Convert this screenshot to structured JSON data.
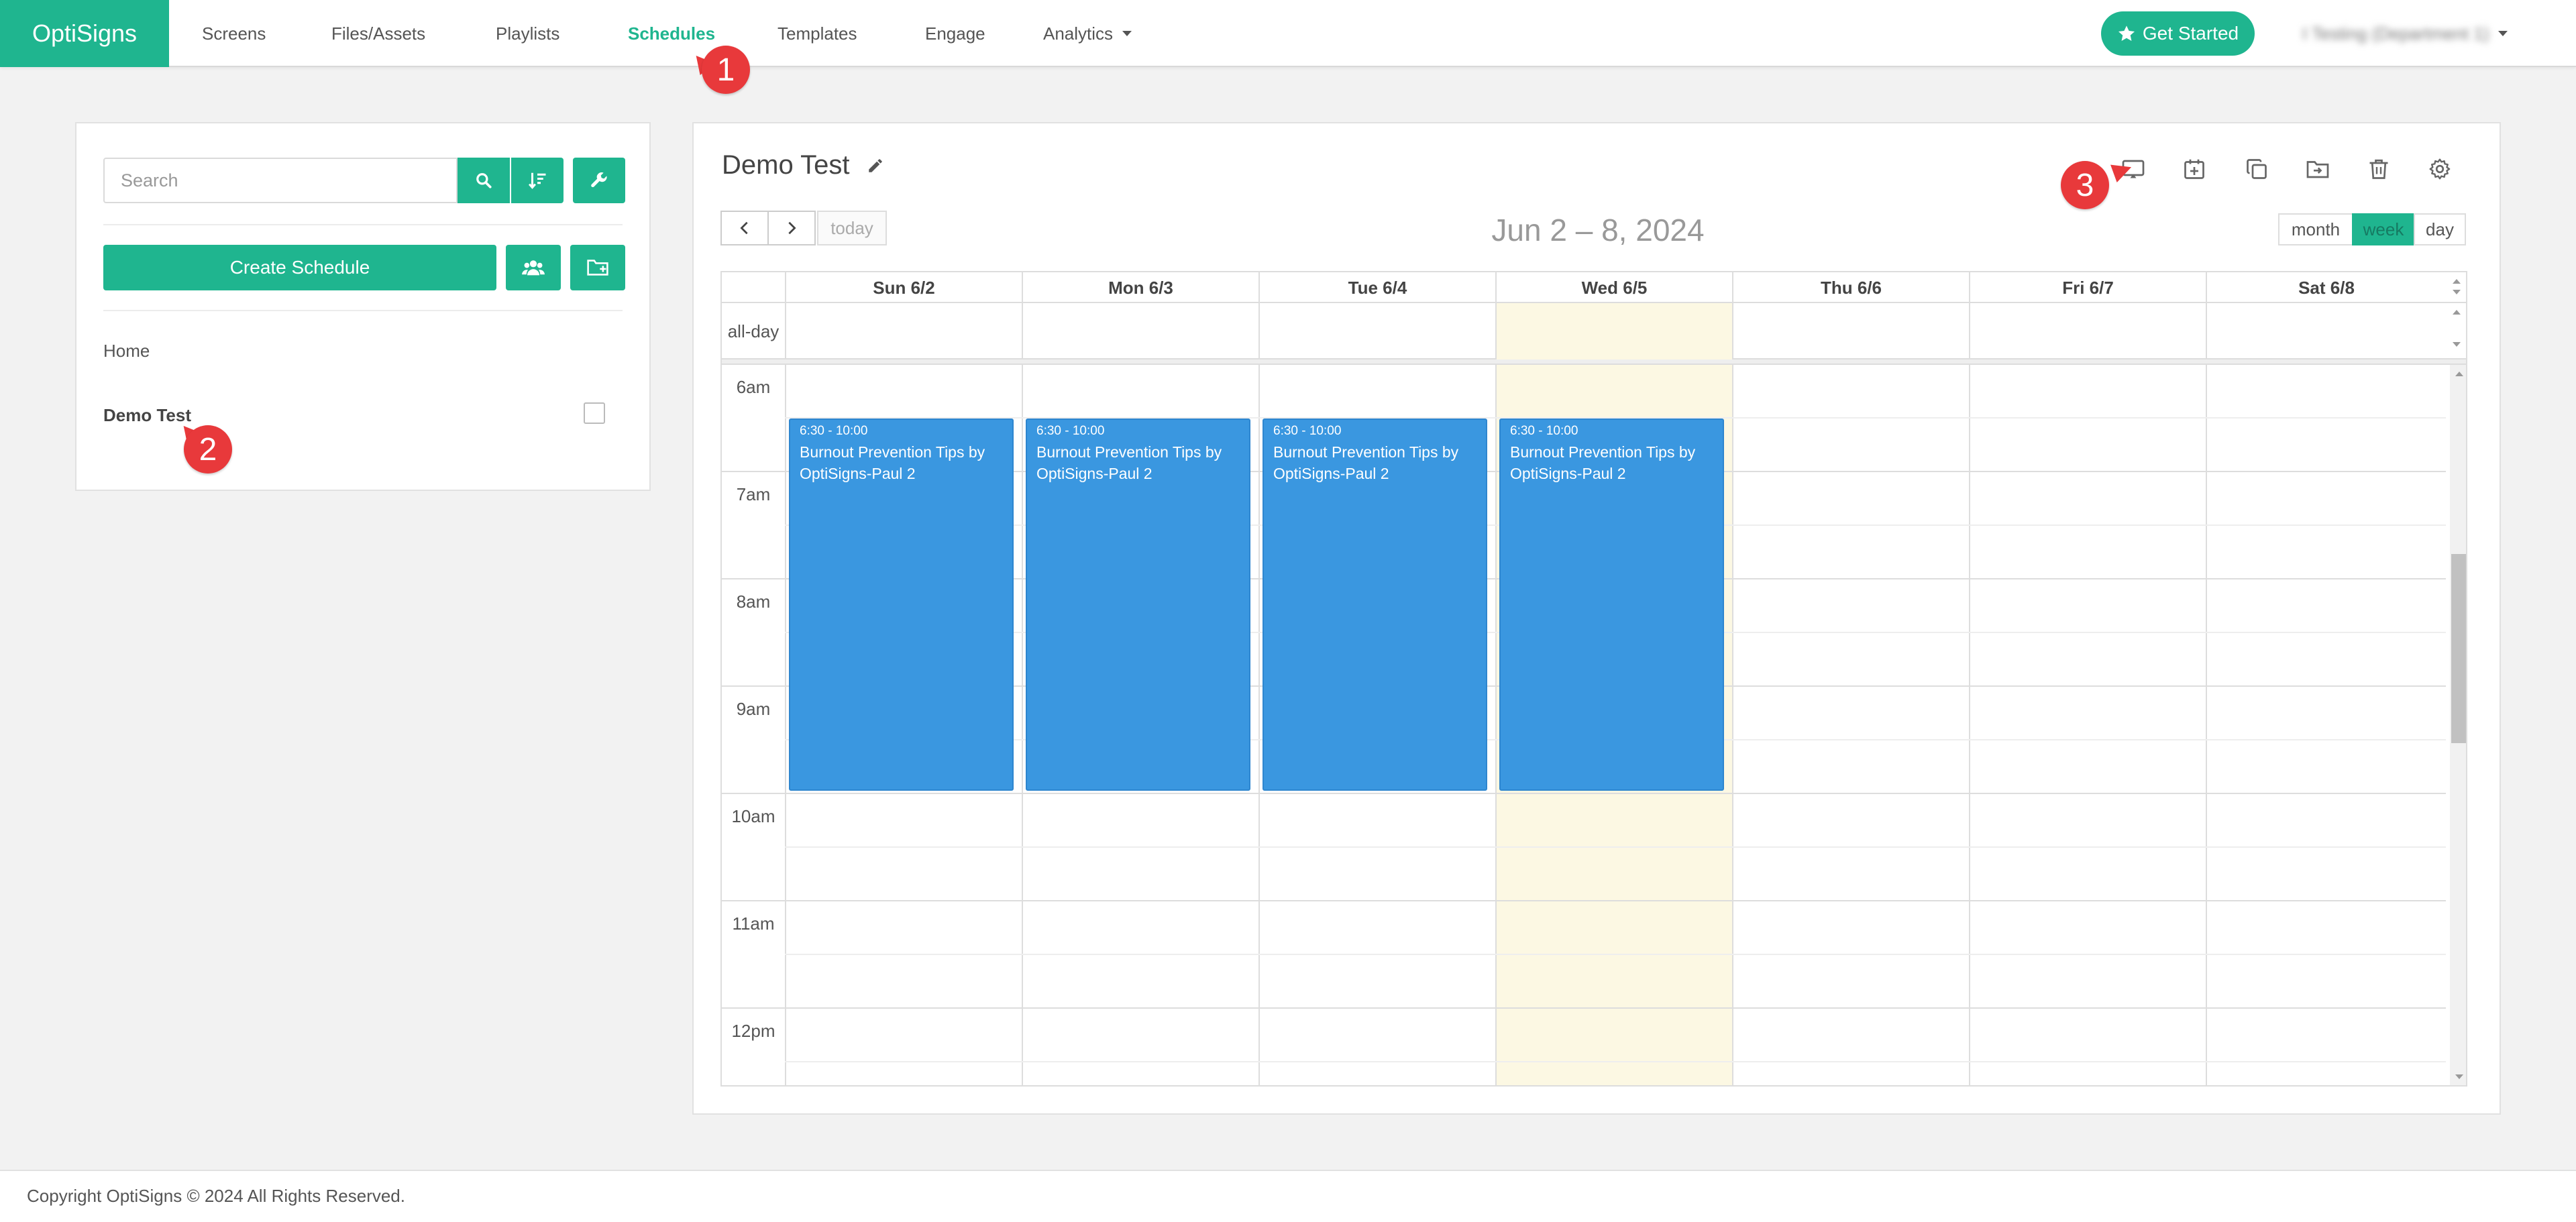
{
  "brand": {
    "name": "OptiSigns"
  },
  "nav": {
    "items": [
      {
        "label": "Screens"
      },
      {
        "label": "Files/Assets"
      },
      {
        "label": "Playlists"
      },
      {
        "label": "Schedules",
        "active": true
      },
      {
        "label": "Templates"
      },
      {
        "label": "Engage"
      },
      {
        "label": "Analytics",
        "dropdown": true
      }
    ],
    "get_started": "Get Started",
    "account": "I Testing (Department 1)"
  },
  "annotations": [
    "1",
    "2",
    "3"
  ],
  "sidebar": {
    "search_placeholder": "Search",
    "create_label": "Create Schedule",
    "tree": [
      {
        "label": "Home"
      },
      {
        "label": "Demo Test",
        "selected": true
      }
    ]
  },
  "schedule": {
    "title": "Demo Test",
    "toolbar_icons": [
      "cast-icon",
      "calendar-add-icon",
      "copy-icon",
      "folder-move-icon",
      "trash-icon",
      "gear-icon"
    ]
  },
  "calendar": {
    "today_label": "today",
    "range_title": "Jun 2 – 8, 2024",
    "views": [
      {
        "label": "month"
      },
      {
        "label": "week",
        "active": true
      },
      {
        "label": "day"
      }
    ],
    "all_day_label": "all-day",
    "days": [
      "Sun 6/2",
      "Mon 6/3",
      "Tue 6/4",
      "Wed 6/5",
      "Thu 6/6",
      "Fri 6/7",
      "Sat 6/8"
    ],
    "today_index": 3,
    "hours": [
      "6am",
      "7am",
      "8am",
      "9am",
      "10am",
      "11am",
      "12pm"
    ],
    "events": [
      {
        "day": 0,
        "time": "6:30 - 10:00",
        "title": "Burnout Prevention Tips by OptiSigns-Paul 2"
      },
      {
        "day": 1,
        "time": "6:30 - 10:00",
        "title": "Burnout Prevention Tips by OptiSigns-Paul 2"
      },
      {
        "day": 2,
        "time": "6:30 - 10:00",
        "title": "Burnout Prevention Tips by OptiSigns-Paul 2"
      },
      {
        "day": 3,
        "time": "6:30 - 10:00",
        "title": "Burnout Prevention Tips by OptiSigns-Paul 2"
      }
    ]
  },
  "footer": {
    "copyright": "Copyright OptiSigns © 2024 All Rights Reserved."
  },
  "colors": {
    "brand": "#1fb58f",
    "event": "#3a97e0",
    "today": "#fcf8e3",
    "annotation": "#e8393b"
  }
}
